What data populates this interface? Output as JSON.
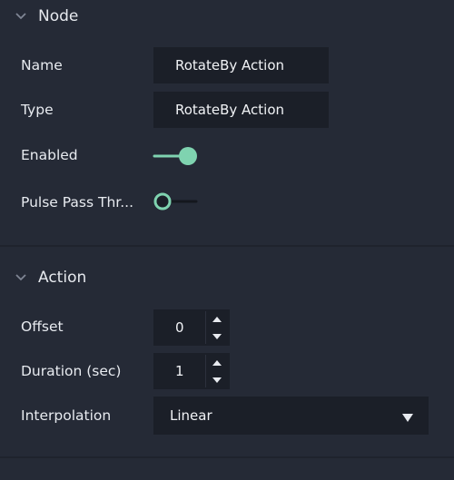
{
  "node_section": {
    "title": "Node",
    "fields": {
      "name": {
        "label": "Name",
        "value": "RotateBy Action"
      },
      "type": {
        "label": "Type",
        "value": "RotateBy Action"
      },
      "enabled": {
        "label": "Enabled",
        "state": "on"
      },
      "pulse_pass_through": {
        "label": "Pulse Pass Thr...",
        "state": "off"
      }
    }
  },
  "action_section": {
    "title": "Action",
    "fields": {
      "offset": {
        "label": "Offset",
        "value": "0"
      },
      "duration": {
        "label": "Duration (sec)",
        "value": "1"
      },
      "interpolation": {
        "label": "Interpolation",
        "value": "Linear"
      }
    }
  },
  "colors": {
    "background": "#252a36",
    "field_bg": "#1b1f28",
    "accent": "#7fd3b0",
    "text": "#e8ebf0"
  },
  "icons": {
    "section_toggle": "chevron-down-icon",
    "stepper_up": "caret-up-icon",
    "stepper_down": "caret-down-icon",
    "dropdown": "triangle-down-icon"
  }
}
